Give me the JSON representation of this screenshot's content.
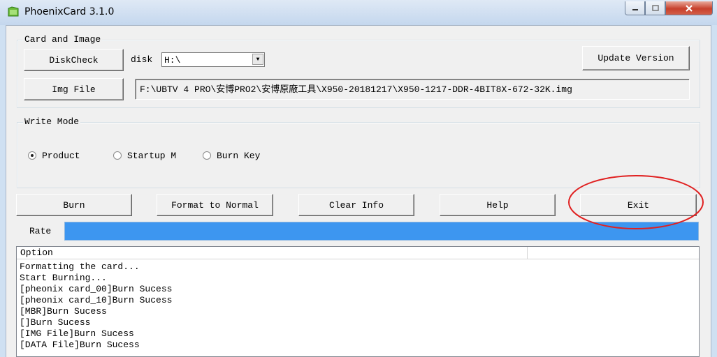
{
  "window": {
    "title": "PhoenixCard 3.1.0",
    "icon": "folder-card-icon"
  },
  "card_image": {
    "group_title": "Card and Image",
    "diskcheck_label": "DiskCheck",
    "disk_label": "disk",
    "disk_value": "H:\\",
    "imgfile_label": "Img File",
    "img_path": "F:\\UBTV 4 PRO\\安博PRO2\\安博原廠工具\\X950-20181217\\X950-1217-DDR-4BIT8X-672-32K.img",
    "update_label": "Update Version"
  },
  "write_mode": {
    "group_title": "Write Mode",
    "options": [
      "Product",
      "Startup M",
      "Burn Key"
    ],
    "selected": "Product"
  },
  "actions": {
    "burn": "Burn",
    "format": "Format to Normal",
    "clear": "Clear Info",
    "help": "Help",
    "exit": "Exit"
  },
  "rate": {
    "label": "Rate",
    "progress_fraction": 1.0,
    "color": "#3d96f0"
  },
  "log": {
    "column_header": "Option",
    "lines": [
      "Formatting the card...",
      "Start Burning...",
      "[pheonix card_00]Burn Sucess",
      "[pheonix card_10]Burn Sucess",
      "[MBR]Burn Sucess",
      "[]Burn Sucess",
      "[IMG File]Burn Sucess",
      "[DATA File]Burn Sucess"
    ]
  },
  "annotation_color": "#e02020"
}
